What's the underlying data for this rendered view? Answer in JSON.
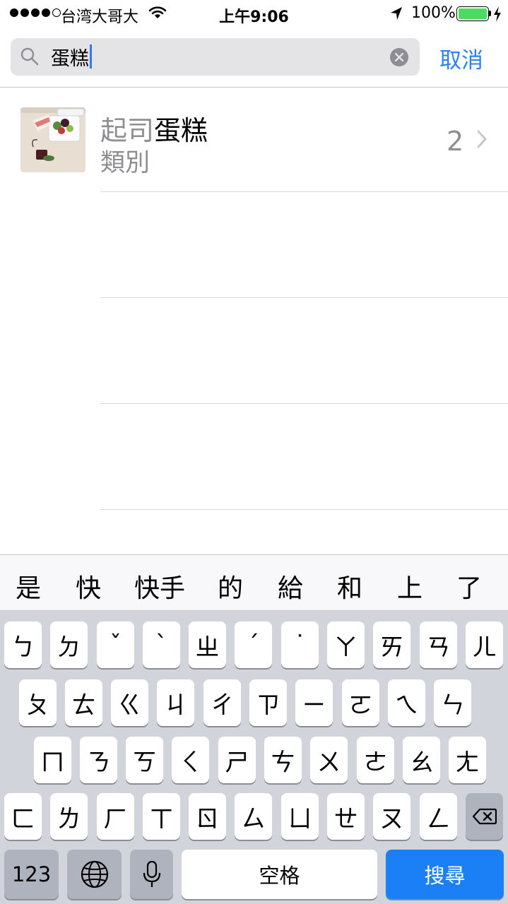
{
  "status_bar": {
    "carrier": "台湾大哥大",
    "time": "上午9:06",
    "battery_percent": "100%",
    "battery_level": 1.0,
    "battery_color": "#4cd964"
  },
  "search": {
    "query": "蛋糕",
    "cancel_label": "取消",
    "icons": [
      "search-icon",
      "clear-icon"
    ]
  },
  "results": [
    {
      "title_prefix": "起司",
      "title_highlight": "蛋糕",
      "subtitle": "類別",
      "count": "2",
      "icon": "chevron-right-icon"
    }
  ],
  "keyboard": {
    "candidates": [
      "是",
      "快",
      "快手",
      "的",
      "給",
      "和",
      "上",
      "了"
    ],
    "rows": [
      [
        "ㄅ",
        "ㄉ",
        "ˇ",
        "ˋ",
        "ㄓ",
        "ˊ",
        "˙",
        "ㄚ",
        "ㄞ",
        "ㄢ",
        "ㄦ"
      ],
      [
        "ㄆ",
        "ㄊ",
        "ㄍ",
        "ㄐ",
        "ㄔ",
        "ㄗ",
        "ㄧ",
        "ㄛ",
        "ㄟ",
        "ㄣ"
      ],
      [
        "ㄇ",
        "ㄋ",
        "ㄎ",
        "ㄑ",
        "ㄕ",
        "ㄘ",
        "ㄨ",
        "ㄜ",
        "ㄠ",
        "ㄤ"
      ],
      [
        "ㄈ",
        "ㄌ",
        "ㄏ",
        "ㄒ",
        "ㄖ",
        "ㄙ",
        "ㄩ",
        "ㄝ",
        "ㄡ",
        "ㄥ"
      ]
    ],
    "numbers_label": "123",
    "space_label": "空格",
    "search_label": "搜尋",
    "accent_color": "#1b80f6"
  }
}
